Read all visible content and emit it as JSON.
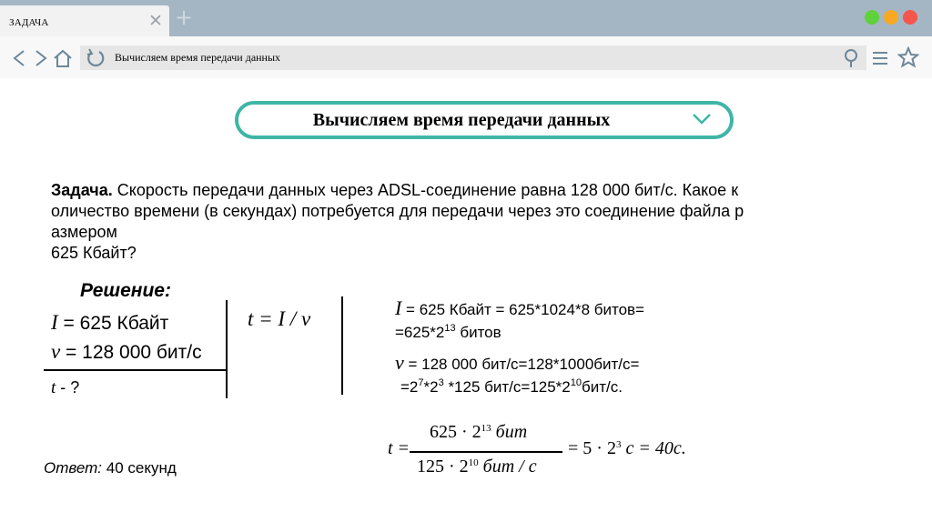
{
  "browser": {
    "tab_title": "ЗАДАЧА",
    "tab_close": "✕",
    "new_tab": "+",
    "address": "Вычисляем время передачи данных"
  },
  "slide": {
    "title": "Вычисляем время передачи данных",
    "task_label": "Задача.",
    "task_lines": [
      " Скорость передачи данных через ADSL-соединение равна 128 000 бит/с. Какое к",
      "оличество времени (в секундах) потребуется для передачи через это соединение файла р",
      "азмером",
      "625 Кбайт?"
    ],
    "solution": {
      "heading": "Решение:",
      "i_sym": "I",
      "i_val": " = 625 Кбайт",
      "v_sym": "v",
      "v_val": " = 128 000 бит/с",
      "t_sym": "t",
      "t_val": " - ?"
    },
    "formula": "t = I / v",
    "calc": {
      "l1_sym": "I",
      "l1": " = 625 Кбайт = 625*1024*8 битов=",
      "l2a": "=625*2",
      "l2exp": "13",
      "l2b": " битов",
      "l3_sym": "v",
      "l3": " = 128 000 бит/с=128*1000бит/с=",
      "l4a": "=2",
      "l4e1": "7",
      "l4b": "*2",
      "l4e2": "3",
      "l4c": " *125 бит/с=125*2",
      "l4e3": "10",
      "l4d": "бит/с."
    },
    "answer": {
      "label": "Ответ:",
      "value": " 40 секунд"
    },
    "fraction": {
      "lhs": "t =",
      "num_a": "625 · 2",
      "num_exp": "13",
      "num_b": " бит",
      "den_a": "125 · 2",
      "den_exp": "10",
      "den_b": " бит / с",
      "rhs_a": "= 5 · 2",
      "rhs_exp": "3",
      "rhs_b": " с = 40с."
    }
  }
}
